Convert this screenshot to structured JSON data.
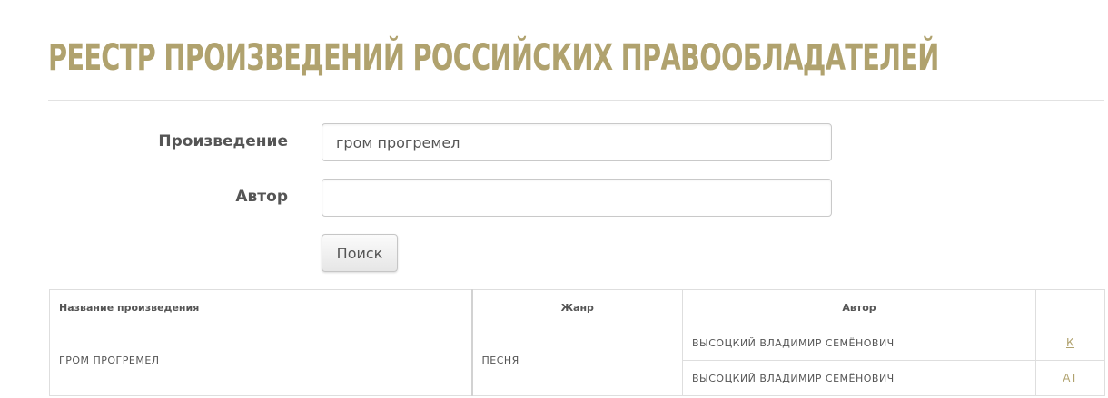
{
  "page": {
    "title": "РЕЕСТР ПРОИЗВЕДЕНИЙ РОССИЙСКИХ ПРАВООБЛАДАТЕЛЕЙ"
  },
  "form": {
    "work_label": "Произведение",
    "work_value": "гром прогремел",
    "author_label": "Автор",
    "author_value": "",
    "search_button": "Поиск"
  },
  "table": {
    "columns": [
      "Название произведения",
      "Жанр",
      "Автор",
      ""
    ],
    "rows": [
      {
        "title": "ГРОМ ПРОГРЕМЕЛ",
        "genre": "ПЕСНЯ",
        "authors": [
          {
            "name": "ВЫСОЦКИЙ ВЛАДИМИР СЕМЁНОВИЧ",
            "role": "К"
          },
          {
            "name": "ВЫСОЦКИЙ ВЛАДИМИР СЕМЁНОВИЧ",
            "role": "АТ"
          }
        ]
      }
    ]
  },
  "colors": {
    "accent": "#b0a26e",
    "text": "#555555",
    "border": "#dedede"
  }
}
